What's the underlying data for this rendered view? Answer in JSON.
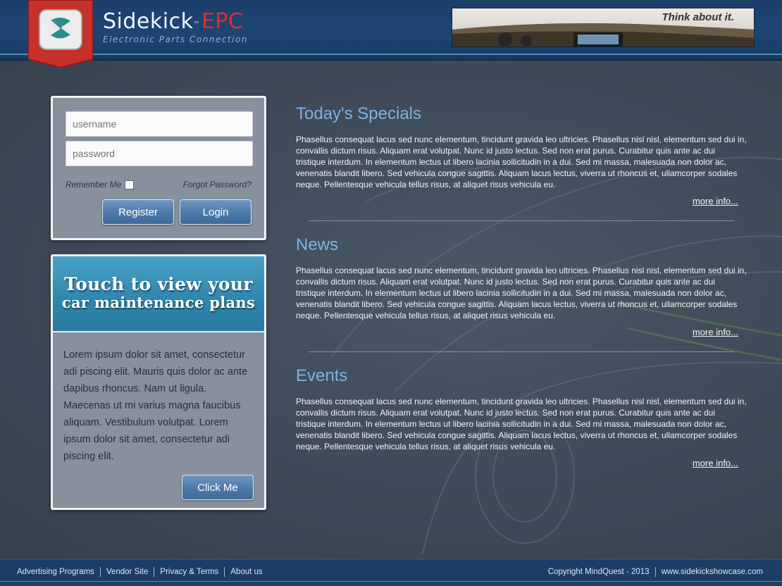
{
  "header": {
    "brand_name": "Sidekick",
    "brand_tm": "™",
    "brand_epc": "EPC",
    "brand_subtitle": "Electronic Parts Connection",
    "ad_tagline": "Think about it.",
    "accent_red": "#d6322f",
    "header_blue": "#1d4574"
  },
  "login": {
    "username_placeholder": "username",
    "password_placeholder": "password",
    "remember_label": "Remember Me",
    "remember_checked": false,
    "forgot_label": "Forgot Password?",
    "register_label": "Register",
    "login_label": "Login"
  },
  "maintenance": {
    "headline_line1": "Touch to view your",
    "headline_line2": "car maintenance plans",
    "body": "Lorem ipsum dolor sit amet, consectetur adi piscing elit. Mauris quis dolor ac ante dapibus rhoncus. Nam ut ligula. Maecenas ut mi varius magna faucibus aliquam. Vestibulum volutpat. Lorem ipsum dolor sit amet, consectetur adi piscing elit.",
    "button_label": "Click Me"
  },
  "sections": [
    {
      "title": "Today's Specials",
      "body": "Phasellus consequat lacus sed nunc elementum, tincidunt gravida leo ultricies. Phasellus nisl nisl, elementum sed dui in, convallis dictum risus. Aliquam erat volutpat. Nunc id justo lectus. Sed non erat purus. Curabitur quis ante ac dui tristique interdum. In elementum lectus ut libero lacinia sollicitudin in a dui. Sed mi massa, malesuada non dolor ac, venenatis blandit libero. Sed vehicula congue sagittis. Aliquam lacus lectus, viverra ut rhoncus et, ullamcorper sodales neque. Pellentesque vehicula tellus risus, at aliquet risus vehicula eu.",
      "more": "more info..."
    },
    {
      "title": "News",
      "body": "Phasellus consequat lacus sed nunc elementum, tincidunt gravida leo ultricies. Phasellus nisl nisl, elementum sed dui in, convallis dictum risus. Aliquam erat volutpat. Nunc id justo lectus. Sed non erat purus. Curabitur quis ante ac dui tristique interdum. In elementum lectus ut libero lacinia sollicitudin in a dui. Sed mi massa, malesuada non dolor ac, venenatis blandit libero. Sed vehicula congue sagittis. Aliquam lacus lectus, viverra ut rhoncus et, ullamcorper sodales neque. Pellentesque vehicula tellus risus, at aliquet risus vehicula eu.",
      "more": "more info..."
    },
    {
      "title": "Events",
      "body": "Phasellus consequat lacus sed nunc elementum, tincidunt gravida leo ultricies. Phasellus nisl nisl, elementum sed dui in, convallis dictum risus. Aliquam erat volutpat. Nunc id justo lectus. Sed non erat purus. Curabitur quis ante ac dui tristique interdum. In elementum lectus ut libero lacinia sollicitudin in a dui. Sed mi massa, malesuada non dolor ac, venenatis blandit libero. Sed vehicula congue sagittis. Aliquam lacus lectus, viverra ut rhoncus et, ullamcorper sodales neque. Pellentesque vehicula tellus risus, at aliquet risus vehicula eu.",
      "more": "more info..."
    }
  ],
  "footer": {
    "links": [
      "Advertising Programs",
      "Vendor Site",
      "Privacy & Terms",
      "About us"
    ],
    "copyright": "Copyright MindQuest - 2013",
    "website": "www.sidekickshowcase.com"
  }
}
